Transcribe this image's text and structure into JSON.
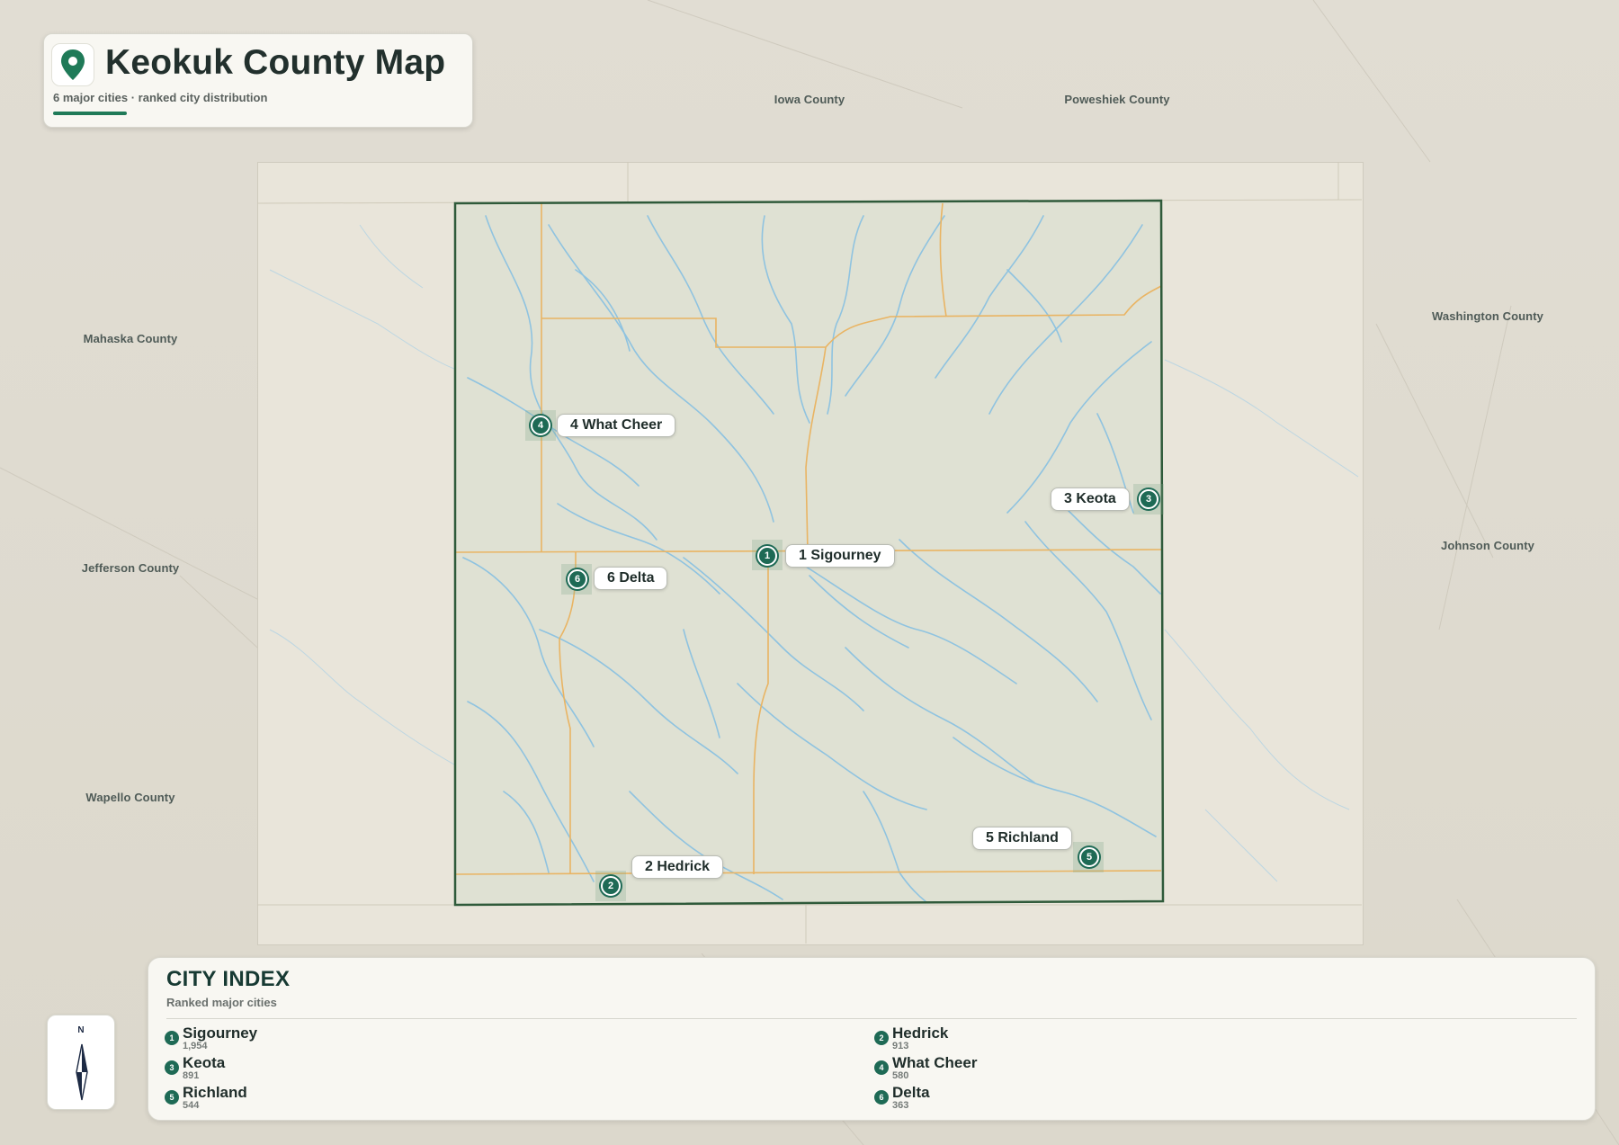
{
  "header": {
    "title": "Keokuk County Map",
    "subtitle": "6 major cities · ranked city distribution",
    "pin_icon": "map-pin-icon",
    "accent_color": "#1f7a58"
  },
  "neighbors": {
    "iowa": "Iowa County",
    "poweshiek": "Poweshiek County",
    "washington": "Washington County",
    "mahaska": "Mahaska County",
    "johnson": "Johnson County",
    "jefferson": "Jefferson County",
    "wapello": "Wapello County"
  },
  "cities": [
    {
      "rank": "1",
      "name": "Sigourney",
      "label": "1 Sigourney",
      "population": "1,954"
    },
    {
      "rank": "2",
      "name": "Hedrick",
      "label": "2 Hedrick",
      "population": "913"
    },
    {
      "rank": "3",
      "name": "Keota",
      "label": "3 Keota",
      "population": "891"
    },
    {
      "rank": "4",
      "name": "What Cheer",
      "label": "4 What Cheer",
      "population": "580"
    },
    {
      "rank": "5",
      "name": "Richland",
      "label": "5 Richland",
      "population": "544"
    },
    {
      "rank": "6",
      "name": "Delta",
      "label": "6 Delta",
      "population": "363"
    }
  ],
  "index": {
    "title": "CITY INDEX",
    "subtitle": "Ranked major cities"
  },
  "compass": {
    "north_label": "N",
    "icon": "compass-icon"
  },
  "colors": {
    "county_border": "#2f5a3a",
    "rivers": "#8fc3e0",
    "roads": "#e9b463",
    "marker": "#1e6a55"
  }
}
